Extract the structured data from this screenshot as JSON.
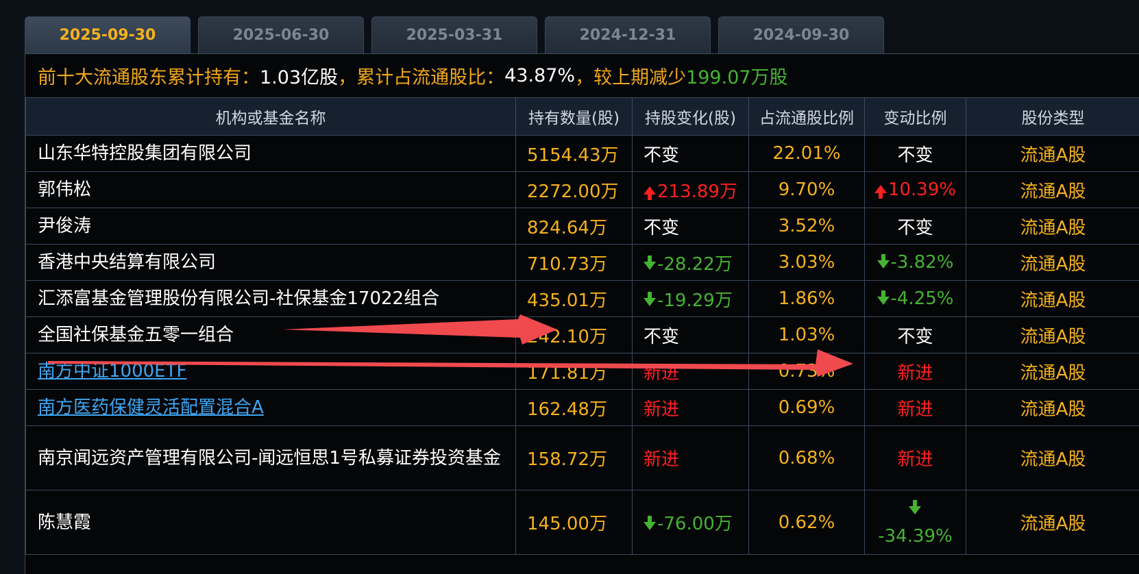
{
  "tabs": [
    "2025-09-30",
    "2025-06-30",
    "2025-03-31",
    "2024-12-31",
    "2024-09-30"
  ],
  "summary": {
    "label1": "前十大流通股东累计持有：",
    "value1": "1.03亿股",
    "label2": "，累计占流通股比：",
    "value2": "43.87%",
    "label3": " ，较上期减少",
    "value3": "199.07万股"
  },
  "table": {
    "headers": [
      "机构或基金名称",
      "持有数量(股)",
      "持股变化(股)",
      "占流通股比例",
      "变动比例",
      "股份类型"
    ],
    "rows": [
      {
        "name": "山东华特控股集团有限公司",
        "qty": "5154.43万",
        "chg": "不变",
        "pct": "22.01%",
        "ratio": "不变",
        "type": "流通A股"
      },
      {
        "name": "郭伟松",
        "qty": "2272.00万",
        "chg": "213.89万",
        "pct": "9.70%",
        "ratio": "10.39%",
        "type": "流通A股"
      },
      {
        "name": "尹俊涛",
        "qty": "824.64万",
        "chg": "不变",
        "pct": "3.52%",
        "ratio": "不变",
        "type": "流通A股"
      },
      {
        "name": "香港中央结算有限公司",
        "qty": "710.73万",
        "chg": "-28.22万",
        "pct": "3.03%",
        "ratio": "-3.82%",
        "type": "流通A股"
      },
      {
        "name": "汇添富基金管理股份有限公司-社保基金17022组合",
        "qty": "435.01万",
        "chg": "-19.29万",
        "pct": "1.86%",
        "ratio": "-4.25%",
        "type": "流通A股"
      },
      {
        "name": "全国社保基金五零一组合",
        "qty": "242.10万",
        "chg": "不变",
        "pct": "1.03%",
        "ratio": "不变",
        "type": "流通A股"
      },
      {
        "name": "南方中证1000ETF",
        "qty": "171.81万",
        "chg": "新进",
        "pct": "0.73%",
        "ratio": "新进",
        "type": "流通A股"
      },
      {
        "name": "南方医药保健灵活配置混合A",
        "qty": "162.48万",
        "chg": "新进",
        "pct": "0.69%",
        "ratio": "新进",
        "type": "流通A股"
      },
      {
        "name": "南京闻远资产管理有限公司-闻远恒思1号私募证券投资基金",
        "qty": "158.72万",
        "chg": "新进",
        "pct": "0.68%",
        "ratio": "新进",
        "type": "流通A股"
      },
      {
        "name": "陈慧霞",
        "qty": "145.00万",
        "chg": "-76.00万",
        "pct": "0.62%",
        "ratio": "-34.39%",
        "type": "流通A股"
      }
    ]
  },
  "colors": {
    "accent": "#f5b21c",
    "up": "#ff2020",
    "down": "#45b432",
    "link": "#3fa6f2",
    "annotation": "#f04a4f"
  }
}
